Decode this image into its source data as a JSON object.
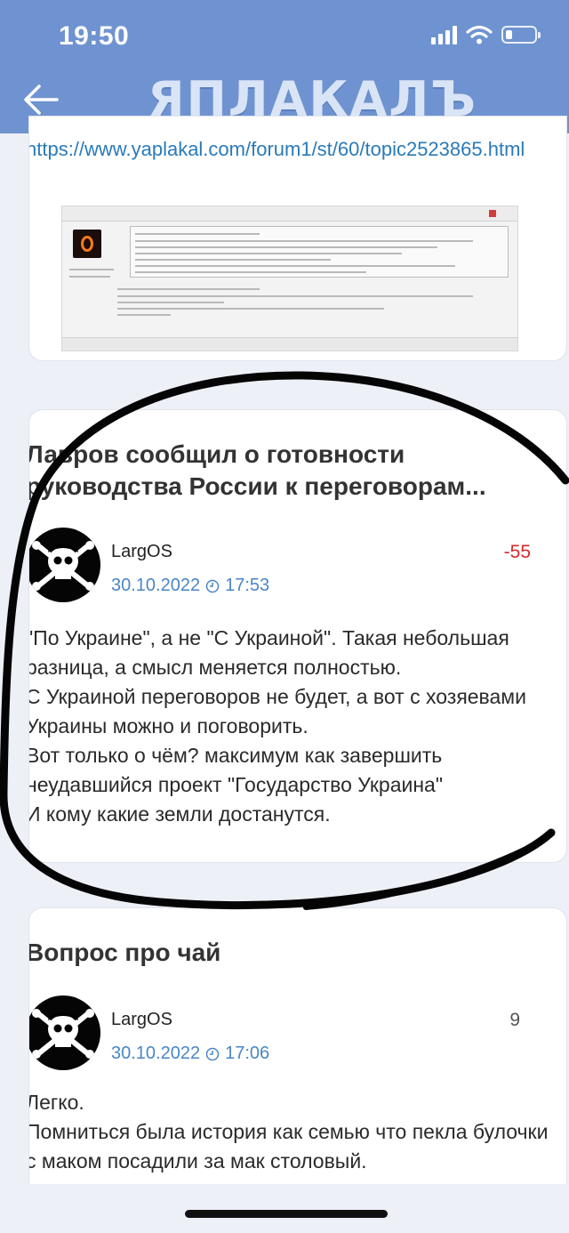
{
  "status_bar": {
    "time": "19:50"
  },
  "header": {
    "logo": "ЯПЛАКАЛЪ"
  },
  "post1": {
    "link": "https://www.yaplakal.com/forum1/st/60/topic2523865.html"
  },
  "post2": {
    "title": "Лавров сообщил о готовности руководства России к переговорам...",
    "author": "LargOS",
    "date": "30.10.2022",
    "time": "17:53",
    "score": "-55",
    "text": "\"По Украине\", а не \"С Украиной\". Такая небольшая разница, а смысл меняется полностью.\nС Украиной переговоров не будет, а вот с хозяевами Украины можно и поговорить.\nВот только о чём? максимум как завершить неудавшийся проект \"Государство Украина\"\nИ кому какие земли достанутся."
  },
  "post3": {
    "title": "Вопрос про чай",
    "author": "LargOS",
    "date": "30.10.2022",
    "time": "17:06",
    "score": "9",
    "text": "Легко.\nПомниться была история как семью что пекла булочки с маком посадили за мак столовый."
  },
  "colors": {
    "header": "#6f93d0",
    "link": "#2a7ab8",
    "negative": "#d62a2a",
    "date": "#4a86c6"
  },
  "icons": [
    "back-arrow-icon",
    "signal-icon",
    "wifi-icon",
    "battery-icon",
    "clock-icon"
  ]
}
